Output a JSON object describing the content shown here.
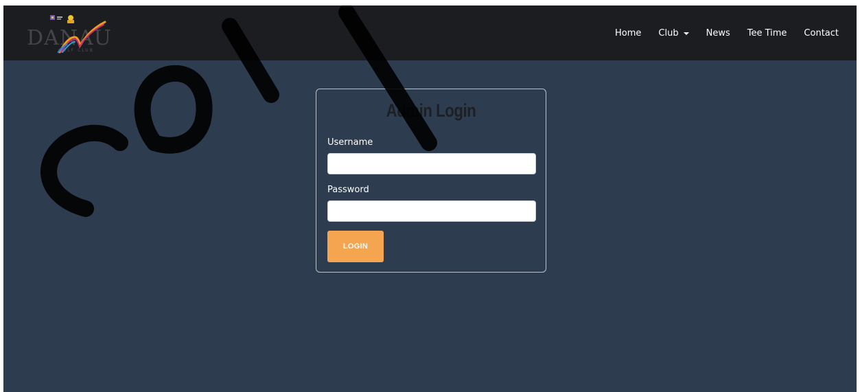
{
  "header": {
    "logo": {
      "wordmark": "DANAU",
      "tagline": "GOLF CLUB"
    },
    "nav": {
      "items": [
        {
          "label": "Home"
        },
        {
          "label": "Club",
          "has_dropdown": true
        },
        {
          "label": "News"
        },
        {
          "label": "Tee Time"
        },
        {
          "label": "Contact"
        }
      ]
    }
  },
  "login": {
    "title": "Admin Login",
    "username_label": "Username",
    "username_value": "",
    "password_label": "Password",
    "password_value": "",
    "submit_label": "LOGIN"
  },
  "colors": {
    "navbar_bg": "#1c1d21",
    "page_bg": "#2e3c50",
    "button_bg": "#f5a54f",
    "title_text": "#1c2026"
  },
  "icons": {
    "dropdown": "caret-down-icon",
    "logo": "danau-logo-icon"
  }
}
